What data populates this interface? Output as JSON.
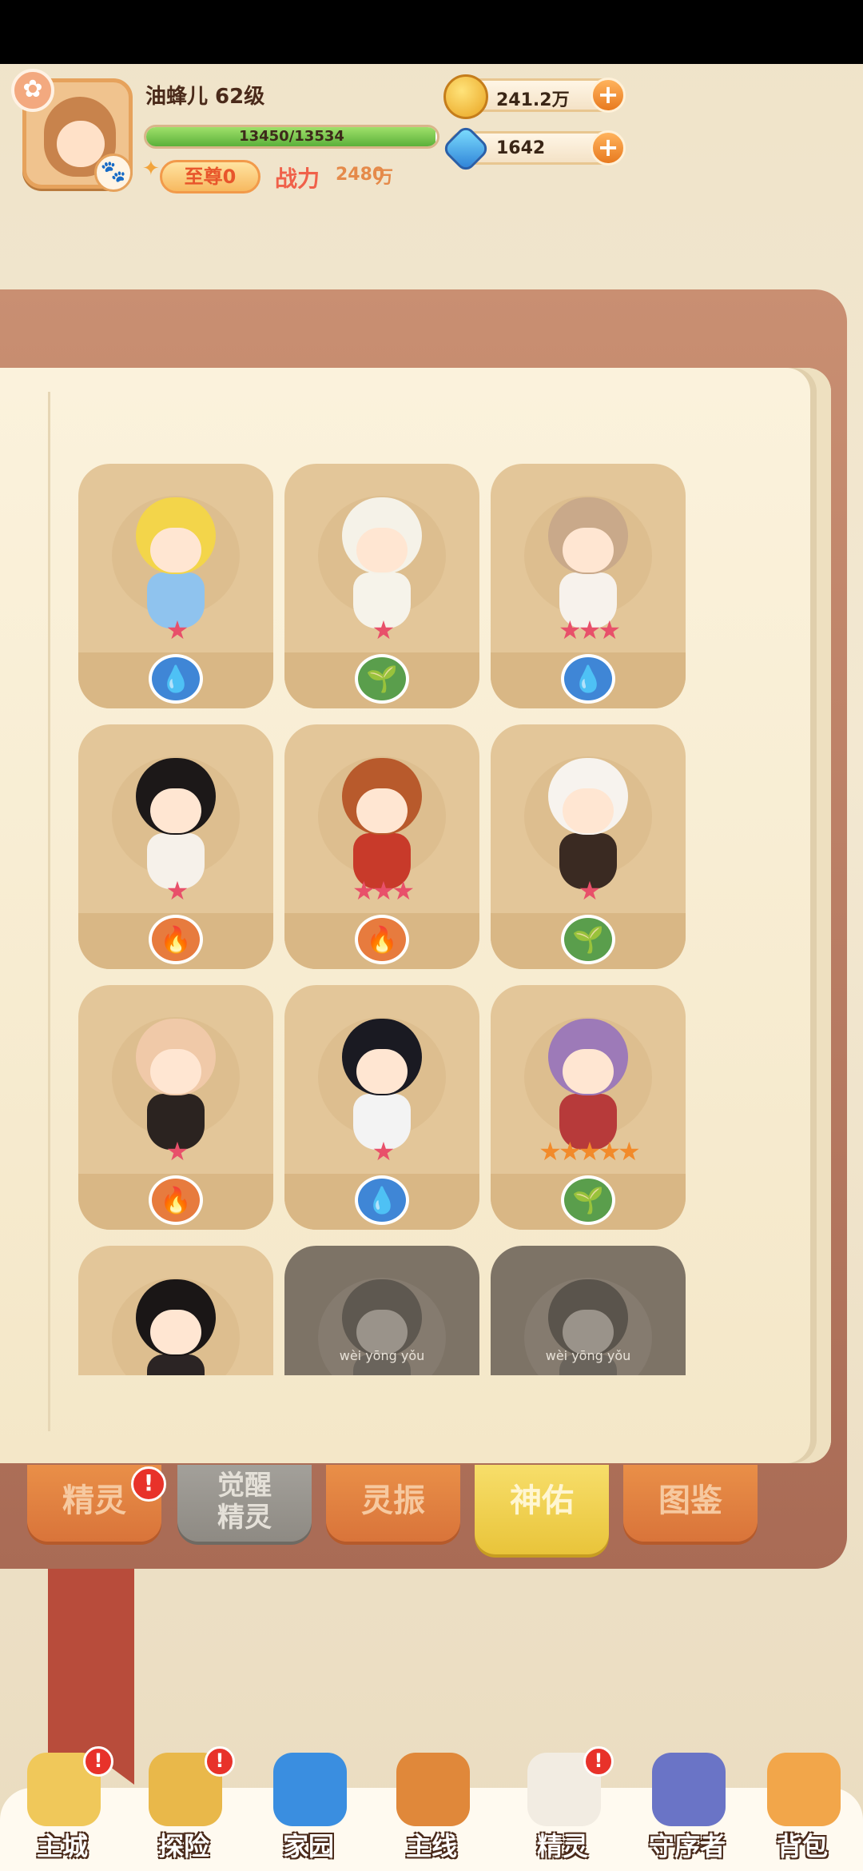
{
  "player": {
    "name": "油蜂儿 62级",
    "xp_text": "13450/13534",
    "xp_fraction": 0.994,
    "vip_label": "至尊0",
    "power_label": "战力",
    "power_value": "2480",
    "power_unit": "万"
  },
  "resources": {
    "coins": "241.2万",
    "gems": "1642",
    "plus": "+"
  },
  "cards": [
    {
      "stars": "★",
      "element": "water",
      "locked": false,
      "hair": "#f3d54a",
      "body": "#8fc3ee"
    },
    {
      "stars": "★",
      "element": "grass",
      "locked": false,
      "hair": "#f5f2e8",
      "body": "#f6f3ea"
    },
    {
      "stars": "★★★",
      "element": "water",
      "locked": false,
      "hair": "#c9a98a",
      "body": "#f7f2ec"
    },
    {
      "stars": "★",
      "element": "fire",
      "locked": false,
      "hair": "#1c1818",
      "body": "#f6f1ea"
    },
    {
      "stars": "★★★",
      "element": "fire",
      "locked": false,
      "hair": "#b85a2c",
      "body": "#c83a2a"
    },
    {
      "stars": "★",
      "element": "grass",
      "locked": false,
      "hair": "#f7f3ee",
      "body": "#3a2a22"
    },
    {
      "stars": "★",
      "element": "fire",
      "locked": false,
      "hair": "#f0c9a8",
      "body": "#2b2320"
    },
    {
      "stars": "★",
      "element": "water",
      "locked": false,
      "hair": "#1a1a22",
      "body": "#f3f3f3"
    },
    {
      "stars": "★★★★★",
      "element": "grass",
      "locked": false,
      "hair": "#9d7ab8",
      "body": "#b73a3a"
    },
    {
      "stars": "",
      "element": "",
      "locked": false,
      "hair": "#1a1616",
      "body": "#2b2424"
    },
    {
      "stars": "",
      "element": "",
      "locked": true,
      "hair": "#5e5850",
      "body": "#6a645c",
      "locked_text": "wèi yōng yǒu"
    },
    {
      "stars": "",
      "element": "",
      "locked": true,
      "hair": "#5a544c",
      "body": "#6a645c",
      "locked_text": "wèi yōng yǒu"
    }
  ],
  "tabs": [
    {
      "label": "精灵",
      "badge": "!"
    },
    {
      "label": "觉醒精灵",
      "line1": "觉醒",
      "line2": "精灵"
    },
    {
      "label": "灵振"
    },
    {
      "label": "神佑"
    },
    {
      "label": "图鉴"
    }
  ],
  "nav": [
    {
      "label": "主城",
      "badge": "!",
      "color": "#f0c85a"
    },
    {
      "label": "探险",
      "badge": "!",
      "color": "#e9b84a"
    },
    {
      "label": "家园",
      "color": "#3a8ee0"
    },
    {
      "label": "主线",
      "color": "#e0883a"
    },
    {
      "label": "精灵",
      "badge": "!",
      "color": "#f2ece2"
    },
    {
      "label": "守序者",
      "color": "#6a74c6"
    },
    {
      "label": "背包",
      "color": "#f2a64a"
    }
  ],
  "icons": {
    "settings": "flower-gear-icon",
    "paw": "paw-icon",
    "coin": "coin-icon",
    "gem": "gem-icon"
  }
}
